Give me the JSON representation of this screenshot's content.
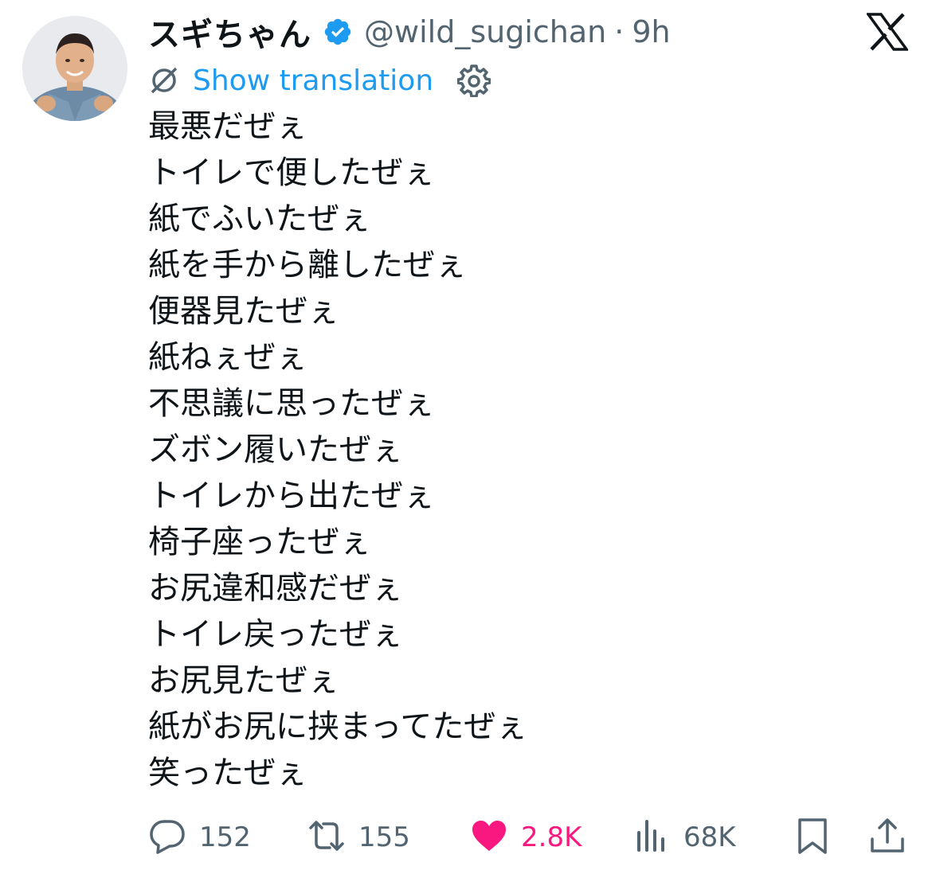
{
  "author": {
    "display_name": "スギちゃん",
    "handle": "@wild_sugichan",
    "separator": "·",
    "time": "9h",
    "verified": true
  },
  "translation": {
    "label": "Show translation"
  },
  "post": {
    "lines": [
      "最悪だぜぇ",
      "トイレで便したぜぇ",
      "紙でふいたぜぇ",
      "紙を手から離したぜぇ",
      "便器見たぜぇ",
      "紙ねぇぜぇ",
      "不思議に思ったぜぇ",
      "ズボン履いたぜぇ",
      "トイレから出たぜぇ",
      "椅子座ったぜぇ",
      "お尻違和感だぜぇ",
      "トイレ戻ったぜぇ",
      "お尻見たぜぇ",
      "紙がお尻に挟まってたぜぇ",
      "笑ったぜぇ"
    ]
  },
  "actions": {
    "replies": "152",
    "reposts": "155",
    "likes": "2.8K",
    "views": "68K"
  },
  "icons": {
    "verified": "verified-badge-icon",
    "logo": "x-logo-icon",
    "translate": "translate-icon",
    "settings": "gear-icon",
    "reply": "reply-icon",
    "repost": "repost-icon",
    "like": "heart-icon",
    "views": "views-icon",
    "bookmark": "bookmark-icon",
    "share": "share-icon"
  },
  "colors": {
    "text": "#0f1419",
    "secondary": "#536471",
    "link": "#1d9bf0",
    "like": "#f91880",
    "verified": "#1d9bf0"
  }
}
